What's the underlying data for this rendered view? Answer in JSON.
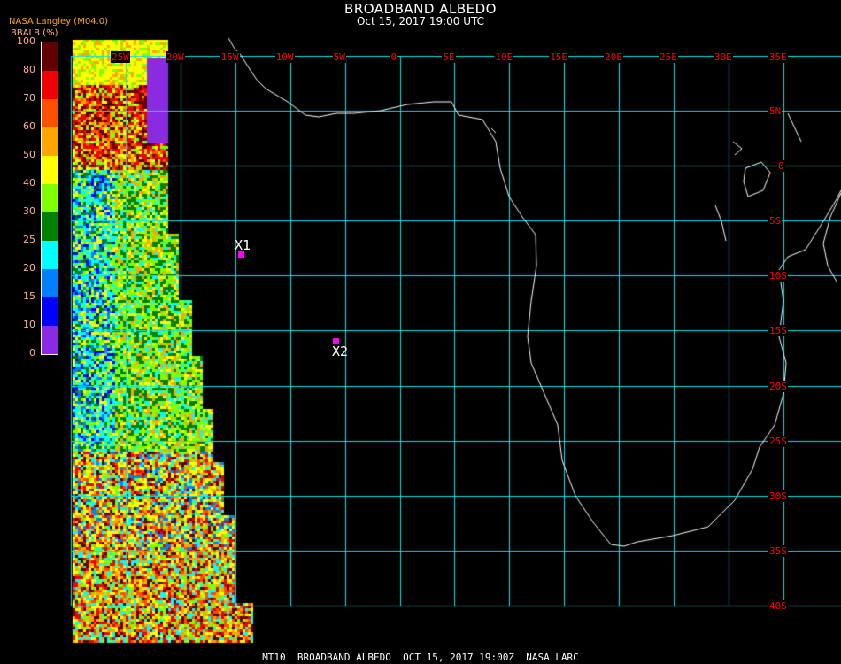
{
  "title": "BROADBAND ALBEDO",
  "subtitle": "Oct 15, 2017 19:00 UTC",
  "org": "NASA Langley (M04.0)",
  "colorbar": {
    "unit": "BBALB (%)",
    "labels": [
      "100",
      "80",
      "70",
      "60",
      "50",
      "40",
      "30",
      "25",
      "20",
      "15",
      "10",
      "0"
    ],
    "colors": [
      "#600000",
      "#f00000",
      "#ff5000",
      "#ffa500",
      "#ffff00",
      "#80ff00",
      "#008000",
      "#00ffff",
      "#0080ff",
      "#0000ff",
      "#8a2be2"
    ]
  },
  "longitudes": [
    "25W",
    "20W",
    "15W",
    "10W",
    "5W",
    "0",
    "5E",
    "10E",
    "15E",
    "20E",
    "25E",
    "30E",
    "35E"
  ],
  "latitudes": [
    "5N",
    "0",
    "5S",
    "10S",
    "15S",
    "20S",
    "25S",
    "30S",
    "35S",
    "40S"
  ],
  "markers": [
    {
      "label": "X1"
    },
    {
      "label": "X2"
    }
  ],
  "colors": {
    "grid": "#00e5ee",
    "coast": "#ffffff",
    "labels": "#ff0000",
    "marker": "#ff00ff"
  },
  "footer": "MT10  BROADBAND ALBEDO  OCT 15, 2017 19:00Z  NASA LARC"
}
